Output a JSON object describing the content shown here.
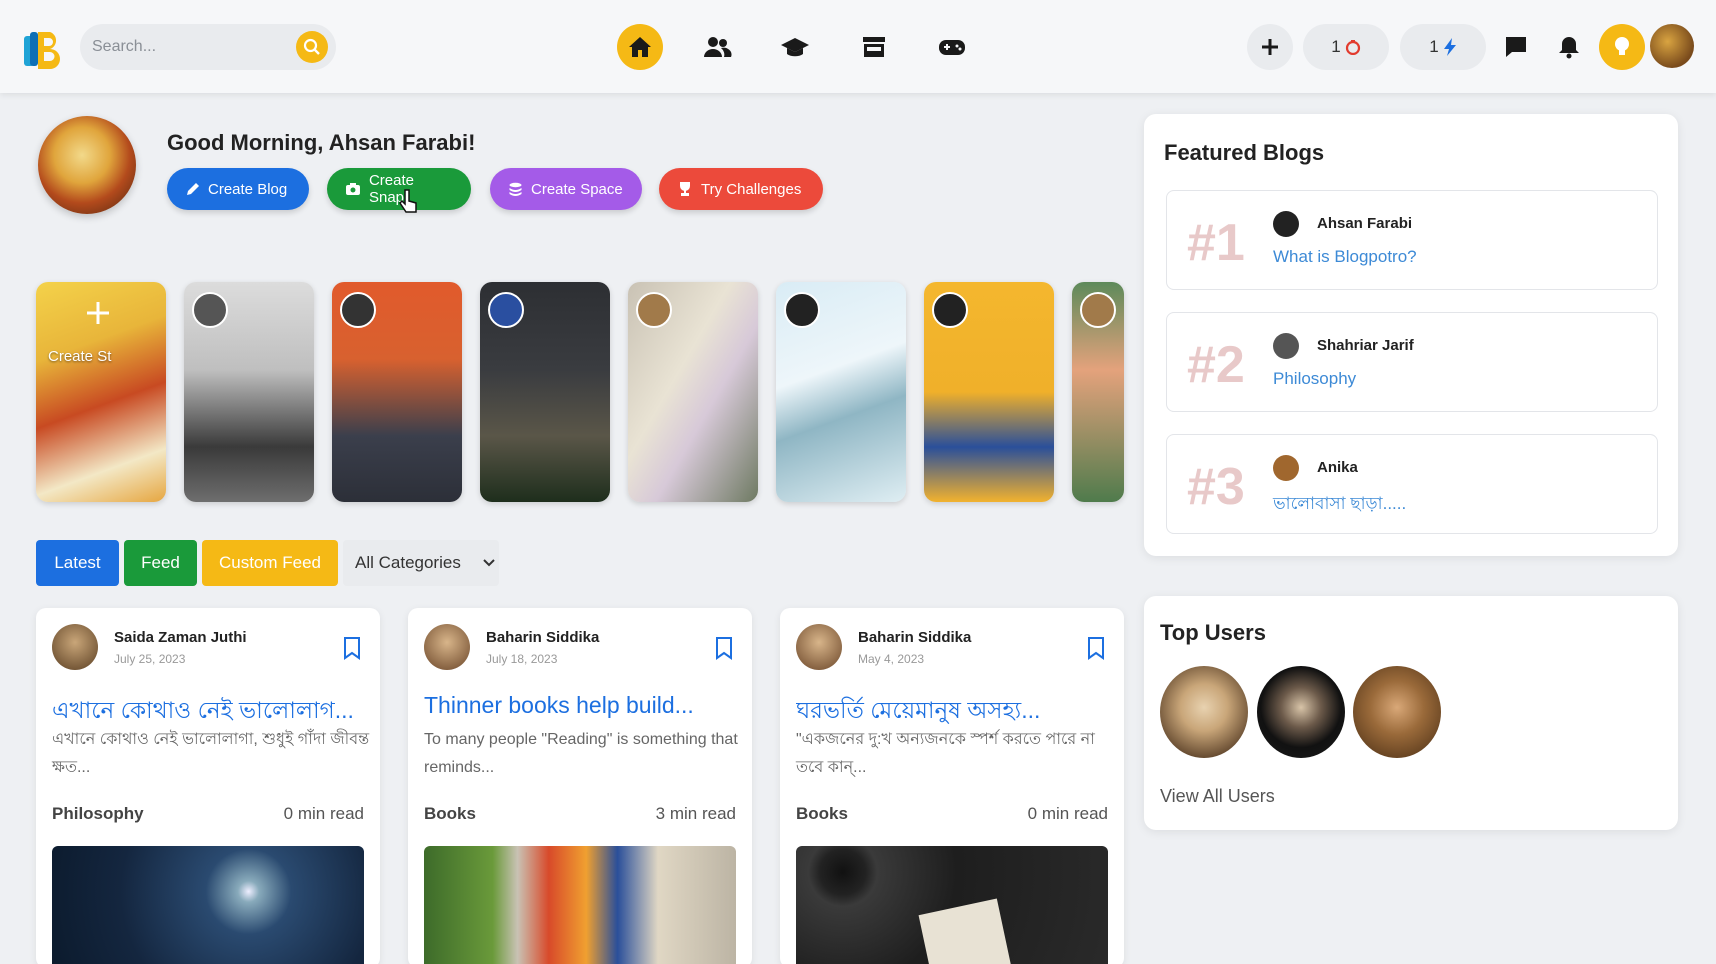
{
  "header": {
    "search_placeholder": "Search...",
    "nav": [
      "home-icon",
      "friends-icon",
      "courses-icon",
      "store-icon",
      "games-icon"
    ],
    "counter_1": "1",
    "counter_2": "1",
    "accent_color": "#f5b915"
  },
  "greeting": {
    "text": "Good Morning, Ahsan Farabi!",
    "buttons": {
      "create_blog": "Create Blog",
      "create_snap": "Create Snap",
      "create_space": "Create Space",
      "try_challenges": "Try Challenges"
    }
  },
  "stories": {
    "create_label": "Create St"
  },
  "filters": {
    "latest": "Latest",
    "feed": "Feed",
    "custom_feed": "Custom Feed",
    "category_select": "All Categories"
  },
  "posts": [
    {
      "author": "Saida Zaman Juthi",
      "date": "July 25, 2023",
      "title": "এখানে কোথাও নেই ভালোলাগ...",
      "excerpt": "এখানে কোথাও নেই ভালোলাগা, শুধুই গাঁদা জীবন্ত ক্ষত...",
      "category": "Philosophy",
      "read_time": "0 min read"
    },
    {
      "author": "Baharin Siddika",
      "date": "July 18, 2023",
      "title": "Thinner books help build...",
      "excerpt": "To many people \"Reading\" is something that reminds...",
      "category": "Books",
      "read_time": "3 min read"
    },
    {
      "author": "Baharin Siddika",
      "date": "May 4, 2023",
      "title": "ঘরভর্তি মেয়েমানুষ অসহ্য...",
      "excerpt": "\"একজনের দু:খ অন্যজনকে স্পর্শ করতে পারে না তবে কান্...",
      "category": "Books",
      "read_time": "0 min read"
    }
  ],
  "featured": {
    "title": "Featured Blogs",
    "items": [
      {
        "rank": "#1",
        "author": "Ahsan Farabi",
        "title": "What is Blogpotro?"
      },
      {
        "rank": "#2",
        "author": "Shahriar Jarif",
        "title": "Philosophy"
      },
      {
        "rank": "#3",
        "author": "Anika",
        "title": "ভালোবাসা ছাড়া....."
      }
    ]
  },
  "top_users": {
    "title": "Top Users",
    "view_all": "View All Users"
  }
}
